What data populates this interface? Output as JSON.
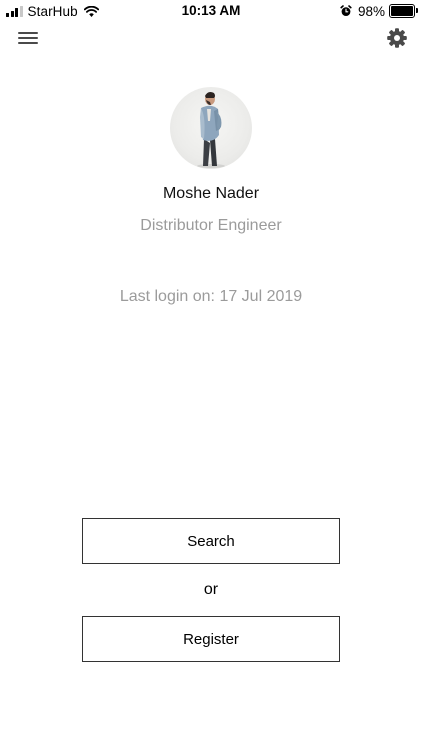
{
  "status_bar": {
    "carrier": "StarHub",
    "time": "10:13 AM",
    "battery_percent_label": "98%",
    "battery_level": 0.98,
    "signal_bars_filled": 3,
    "signal_bars_total": 4,
    "icons": [
      "signal-icon",
      "wifi-icon",
      "alarm-icon",
      "battery-icon"
    ]
  },
  "nav": {
    "menu_icon": "hamburger-menu-icon",
    "settings_icon": "gear-icon"
  },
  "profile": {
    "name": "Moshe Nader",
    "role": "Distributor Engineer",
    "last_login": "Last login on: 17 Jul 2019"
  },
  "actions": {
    "search_label": "Search",
    "or_label": "or",
    "register_label": "Register"
  },
  "colors": {
    "background": "#ffffff",
    "primary_text": "#111111",
    "secondary_text": "#9b9b9b",
    "icon_gray": "#4a4a4a",
    "button_border": "#333333"
  }
}
